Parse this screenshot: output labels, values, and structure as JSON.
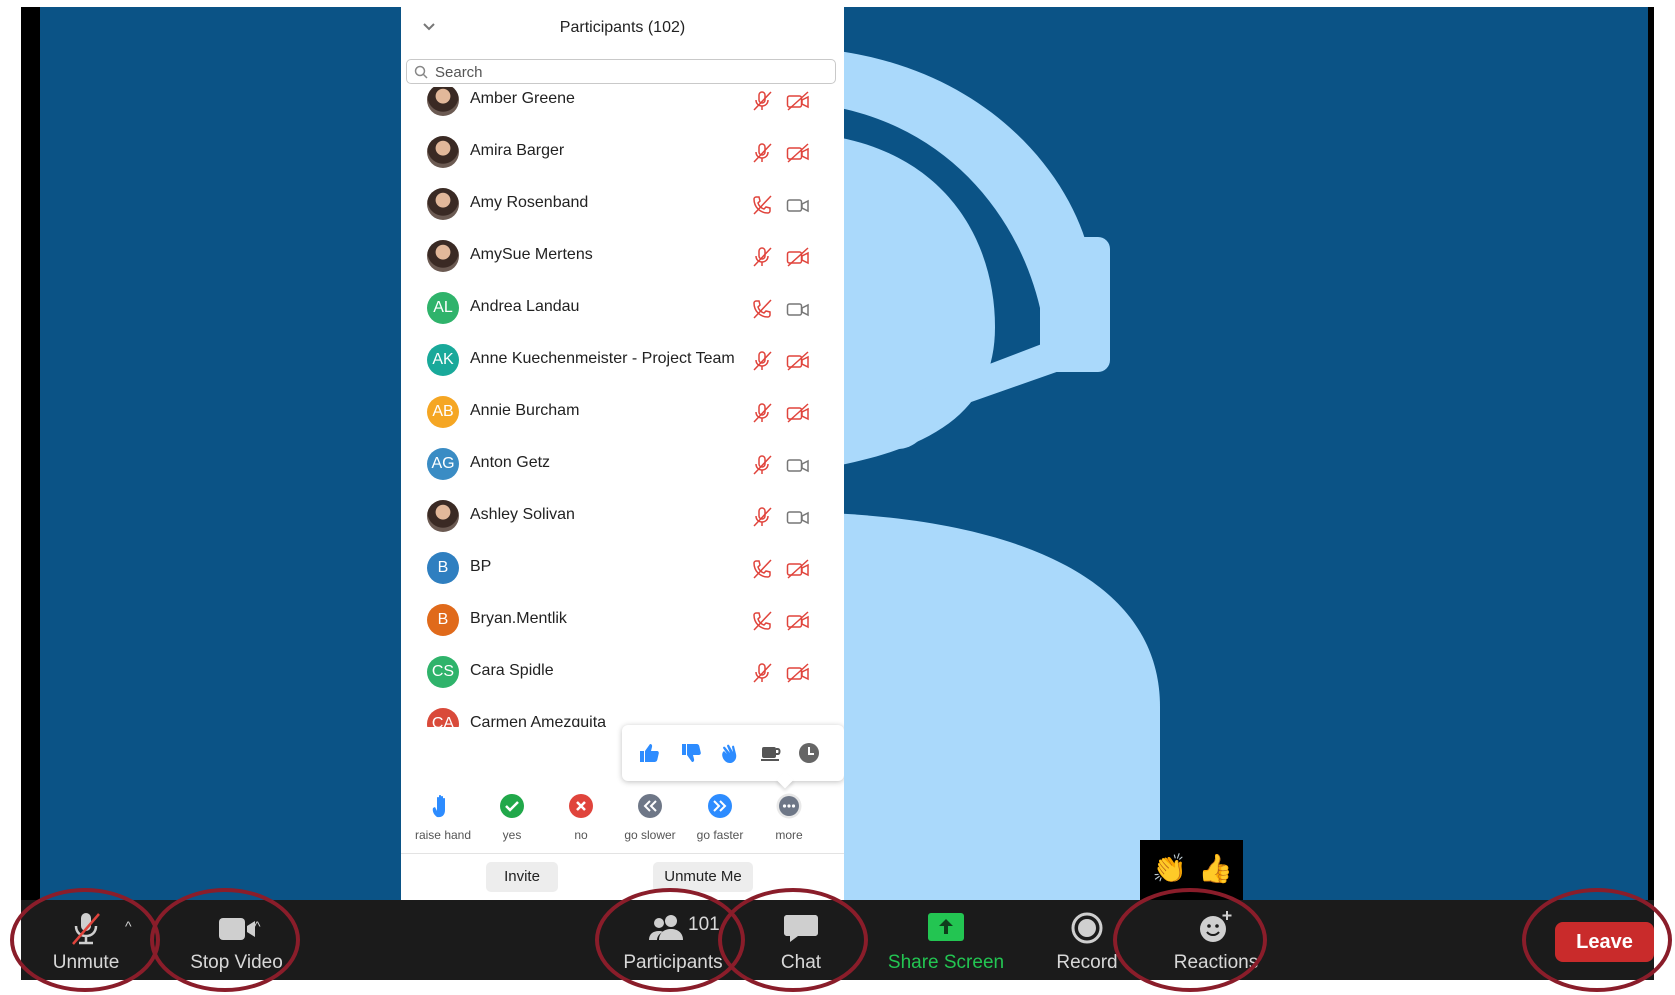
{
  "panel": {
    "title": "Participants (102)",
    "search_placeholder": "Search",
    "participants": [
      {
        "name": "Amber Greene",
        "initials": "",
        "avatar_color": "",
        "mic": "muted",
        "video": "off"
      },
      {
        "name": "Amira Barger",
        "initials": "",
        "avatar_color": "",
        "mic": "muted",
        "video": "off"
      },
      {
        "name": "Amy Rosenband",
        "initials": "",
        "avatar_color": "",
        "mic": "phone-muted",
        "video": "on"
      },
      {
        "name": "AmySue Mertens",
        "initials": "",
        "avatar_color": "",
        "mic": "muted",
        "video": "off"
      },
      {
        "name": "Andrea Landau",
        "initials": "AL",
        "avatar_color": "#2fb36b",
        "mic": "phone-muted",
        "video": "on"
      },
      {
        "name": "Anne Kuechenmeister - Project Team",
        "initials": "AK",
        "avatar_color": "#19a99a",
        "mic": "muted",
        "video": "off"
      },
      {
        "name": "Annie Burcham",
        "initials": "AB",
        "avatar_color": "#f5a623",
        "mic": "muted",
        "video": "off"
      },
      {
        "name": "Anton Getz",
        "initials": "AG",
        "avatar_color": "#3a8cc4",
        "mic": "muted",
        "video": "on"
      },
      {
        "name": "Ashley Solivan",
        "initials": "",
        "avatar_color": "",
        "mic": "muted",
        "video": "on"
      },
      {
        "name": "BP",
        "initials": "B",
        "avatar_color": "#2f7fc0",
        "mic": "phone-muted",
        "video": "off"
      },
      {
        "name": "Bryan.Mentlik",
        "initials": "B",
        "avatar_color": "#e06a1b",
        "mic": "phone-muted",
        "video": "off"
      },
      {
        "name": "Cara Spidle",
        "initials": "CS",
        "avatar_color": "#2fb36b",
        "mic": "muted",
        "video": "off"
      },
      {
        "name": "Carmen Amezquita",
        "initials": "CA",
        "avatar_color": "#d94a3a",
        "mic": "",
        "video": ""
      }
    ],
    "reaction_popup_icons": [
      "thumbs-up-icon",
      "thumbs-down-icon",
      "clap-icon",
      "coffee-icon",
      "clock-icon"
    ],
    "feedback": [
      {
        "label": "raise hand",
        "icon": "raise-hand-icon"
      },
      {
        "label": "yes",
        "icon": "yes-check-icon"
      },
      {
        "label": "no",
        "icon": "no-x-icon"
      },
      {
        "label": "go slower",
        "icon": "go-slower-icon"
      },
      {
        "label": "go faster",
        "icon": "go-faster-icon"
      },
      {
        "label": "more",
        "icon": "more-dots-icon"
      }
    ],
    "invite_label": "Invite",
    "unmute_me_label": "Unmute Me"
  },
  "reaction_bubble": [
    "👏",
    "👍"
  ],
  "toolbar": {
    "unmute_label": "Unmute",
    "stop_video_label": "Stop Video",
    "participants_label": "Participants",
    "participants_count": "101",
    "chat_label": "Chat",
    "share_screen_label": "Share Screen",
    "record_label": "Record",
    "reactions_label": "Reactions",
    "leave_label": "Leave"
  },
  "colors": {
    "stage_bg": "#0b5386",
    "figure": "#aad9fb",
    "muted_red": "#e0443c",
    "share_green": "#23c552",
    "leave_red": "#c92b2b",
    "highlight_circle": "#8a1d2a"
  }
}
